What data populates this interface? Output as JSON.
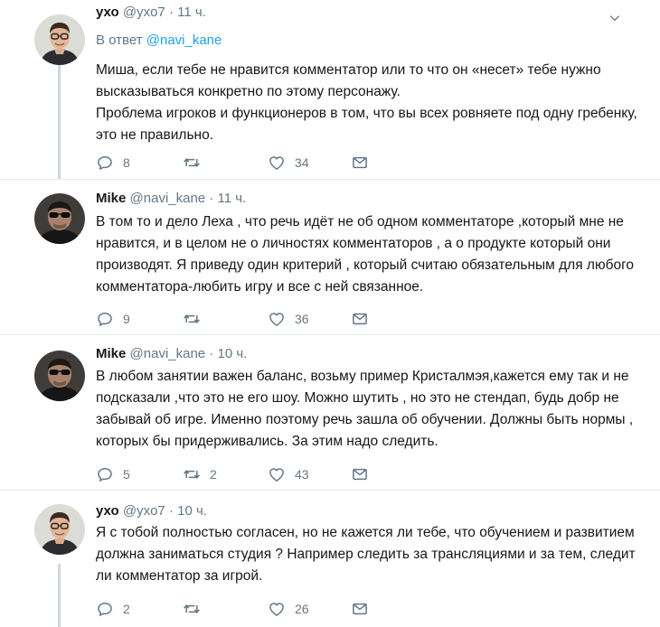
{
  "tweets": [
    {
      "name": "ухо",
      "handle": "@yxo7",
      "time": "11 ч.",
      "reply_prefix": "В ответ",
      "reply_to": "@navi_kane",
      "paragraphs": [
        "Миша, если тебе не нравится комментатор или то что он «несет» тебе нужно высказываться конкретно по этому персонажу.",
        "Проблема игроков и функционеров в том, что вы всех ровняете под одну гребенку, это не правильно."
      ],
      "replies": "8",
      "retweets": "",
      "likes": "34",
      "avatar_icon": "person-glasses-avatar"
    },
    {
      "name": "Mike",
      "handle": "@navi_kane",
      "time": "11 ч.",
      "paragraphs": [
        "В том то и дело Леха , что речь идёт не об одном комментаторе ,который мне не нравится,  и в целом не о личностях комментаторов , а о продукте который они производят. Я приведу один критерий , который считаю обязательным для любого комментатора-любить игру и все с ней связанное."
      ],
      "replies": "9",
      "retweets": "",
      "likes": "36",
      "avatar_icon": "person-sunglasses-avatar"
    },
    {
      "name": "Mike",
      "handle": "@navi_kane",
      "time": "10 ч.",
      "paragraphs": [
        "В любом занятии важен баланс, возьму пример Кристалмэя,кажется ему так и не подсказали ,что это не его шоу. Можно шутить , но это не стендап, будь добр не забывай об игре. Именно поэтому речь зашла об обучении. Должны быть нормы , которых бы придерживались. За этим надо следить."
      ],
      "replies": "5",
      "retweets": "2",
      "likes": "43",
      "avatar_icon": "person-sunglasses-avatar"
    },
    {
      "name": "ухо",
      "handle": "@yxo7",
      "time": "10 ч.",
      "paragraphs": [
        "Я с тобой полностью согласен, но не кажется ли тебе, что обучением и развитием должна заниматься студия ? Например следить за трансляциями и за тем, следит ли комментатор за игрой."
      ],
      "replies": "2",
      "retweets": "",
      "likes": "26",
      "avatar_icon": "person-glasses-avatar"
    }
  ],
  "colors": {
    "accent": "#1da1f2",
    "muted": "#657786",
    "thread_line": "#ccd6dd",
    "divider": "#e6ecf0"
  },
  "icons": [
    "reply-icon",
    "retweet-icon",
    "like-icon",
    "direct-message-icon",
    "caret-down-icon"
  ]
}
